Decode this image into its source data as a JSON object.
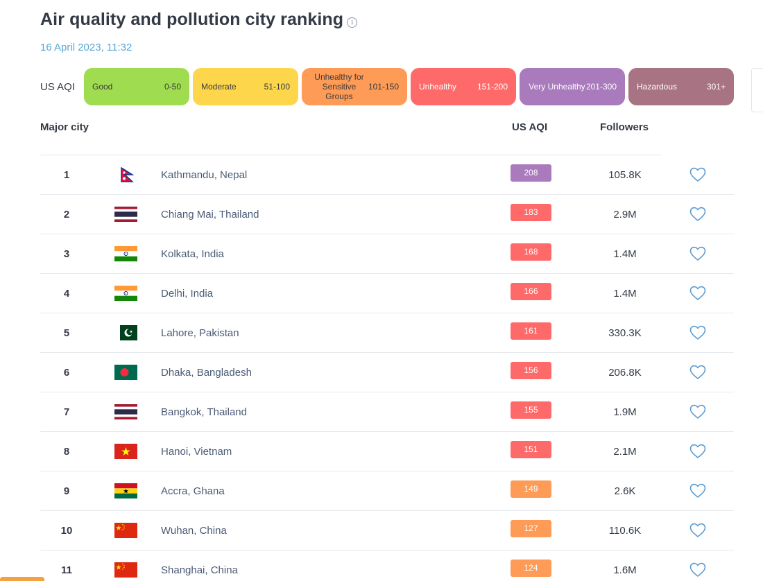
{
  "page": {
    "title": "Air quality and pollution city ranking",
    "info_icon": "info-icon",
    "date": "16 April 2023, 11:32"
  },
  "legend": {
    "label": "US AQI",
    "items": [
      {
        "name": "Good",
        "range": "0-50",
        "color": "#a0dc50",
        "text_color": "#3a3a3a"
      },
      {
        "name": "Moderate",
        "range": "51-100",
        "color": "#fdd64b",
        "text_color": "#3a3a3a"
      },
      {
        "name": "Unhealthy for Sensitive Groups",
        "range": "101-150",
        "color": "#fd9b57",
        "text_color": "#3a3a3a"
      },
      {
        "name": "Unhealthy",
        "range": "151-200",
        "color": "#fe6a69",
        "text_color": "#ffffff"
      },
      {
        "name": "Very Unhealthy",
        "range": "201-300",
        "color": "#a97abc",
        "text_color": "#ffffff"
      },
      {
        "name": "Hazardous",
        "range": "301+",
        "color": "#a87383",
        "text_color": "#ffffff"
      }
    ]
  },
  "table": {
    "headers": {
      "city": "Major city",
      "aqi": "US AQI",
      "followers": "Followers"
    },
    "rows": [
      {
        "rank": "1",
        "city": "Kathmandu, Nepal",
        "flag": "nepal",
        "aqi": "208",
        "aqi_color": "#a97abc",
        "followers": "105.8K"
      },
      {
        "rank": "2",
        "city": "Chiang Mai, Thailand",
        "flag": "thailand",
        "aqi": "183",
        "aqi_color": "#fe6a69",
        "followers": "2.9M"
      },
      {
        "rank": "3",
        "city": "Kolkata, India",
        "flag": "india",
        "aqi": "168",
        "aqi_color": "#fe6a69",
        "followers": "1.4M"
      },
      {
        "rank": "4",
        "city": "Delhi, India",
        "flag": "india",
        "aqi": "166",
        "aqi_color": "#fe6a69",
        "followers": "1.4M"
      },
      {
        "rank": "5",
        "city": "Lahore, Pakistan",
        "flag": "pakistan",
        "aqi": "161",
        "aqi_color": "#fe6a69",
        "followers": "330.3K"
      },
      {
        "rank": "6",
        "city": "Dhaka, Bangladesh",
        "flag": "bangladesh",
        "aqi": "156",
        "aqi_color": "#fe6a69",
        "followers": "206.8K"
      },
      {
        "rank": "7",
        "city": "Bangkok, Thailand",
        "flag": "thailand",
        "aqi": "155",
        "aqi_color": "#fe6a69",
        "followers": "1.9M"
      },
      {
        "rank": "8",
        "city": "Hanoi, Vietnam",
        "flag": "vietnam",
        "aqi": "151",
        "aqi_color": "#fe6a69",
        "followers": "2.1M"
      },
      {
        "rank": "9",
        "city": "Accra, Ghana",
        "flag": "ghana",
        "aqi": "149",
        "aqi_color": "#fd9b57",
        "followers": "2.6K"
      },
      {
        "rank": "10",
        "city": "Wuhan, China",
        "flag": "china",
        "aqi": "127",
        "aqi_color": "#fd9b57",
        "followers": "110.6K"
      },
      {
        "rank": "11",
        "city": "Shanghai, China",
        "flag": "china",
        "aqi": "124",
        "aqi_color": "#fd9b57",
        "followers": "1.6M"
      }
    ],
    "follow_icon": "heart-icon"
  }
}
